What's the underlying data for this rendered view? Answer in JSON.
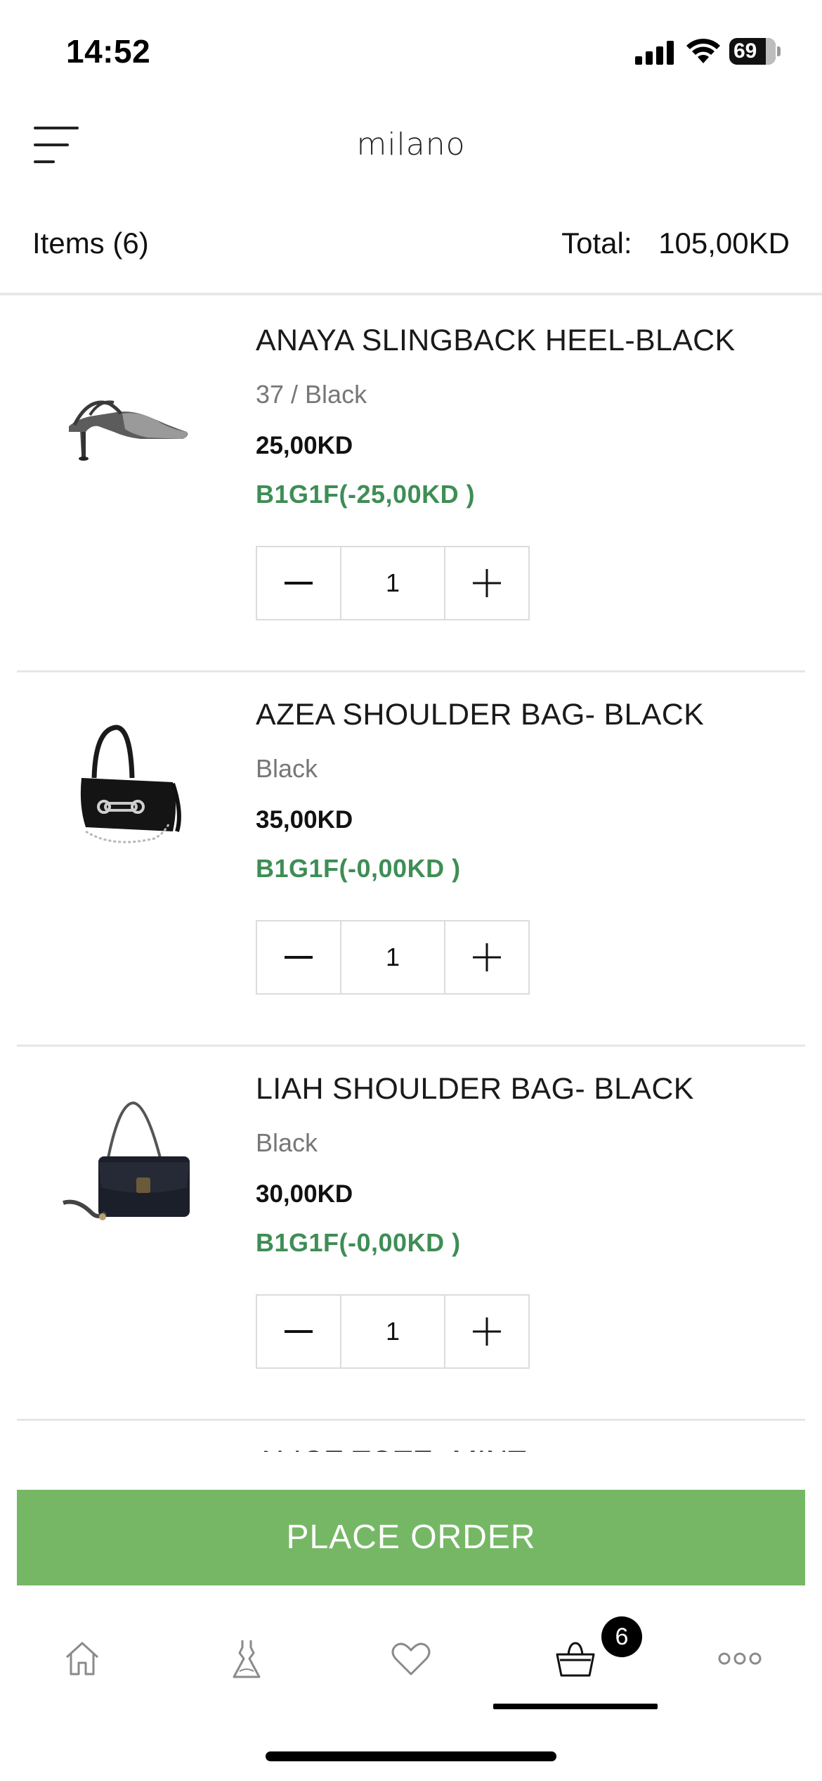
{
  "status_bar": {
    "time": "14:52",
    "battery": "69"
  },
  "header": {
    "logo_text": "milano",
    "menu_icon": "menu-icon"
  },
  "summary": {
    "items_label": "Items (6)",
    "total_label": "Total:",
    "total_value": "105,00KD"
  },
  "cart": {
    "items": [
      {
        "name": "ANAYA SLINGBACK HEEL-BLACK",
        "variant": "37 / Black",
        "price": "25,00KD",
        "promo": "B1G1F(-25,00KD )",
        "quantity": "1",
        "image": "slingback-heel-image"
      },
      {
        "name": "AZEA SHOULDER BAG- BLACK",
        "variant": "Black",
        "price": "35,00KD",
        "promo": "B1G1F(-0,00KD )",
        "quantity": "1",
        "image": "shoulder-bag-image"
      },
      {
        "name": "LIAH SHOULDER BAG- BLACK",
        "variant": "Black",
        "price": "30,00KD",
        "promo": "B1G1F(-0,00KD )",
        "quantity": "1",
        "image": "shoulder-bag-image"
      }
    ],
    "peek_item_name": "ALICE TOTE- MINT"
  },
  "actions": {
    "place_order": "PLACE ORDER"
  },
  "tab_bar": {
    "tabs": [
      "home-icon",
      "dress-icon",
      "heart-icon",
      "basket-icon",
      "more-icon"
    ],
    "cart_badge": "6",
    "active_tab": "basket-icon"
  },
  "colors": {
    "accent": "#76b766",
    "promo": "#3e8e55",
    "text": "#111111",
    "muted": "#777777"
  }
}
